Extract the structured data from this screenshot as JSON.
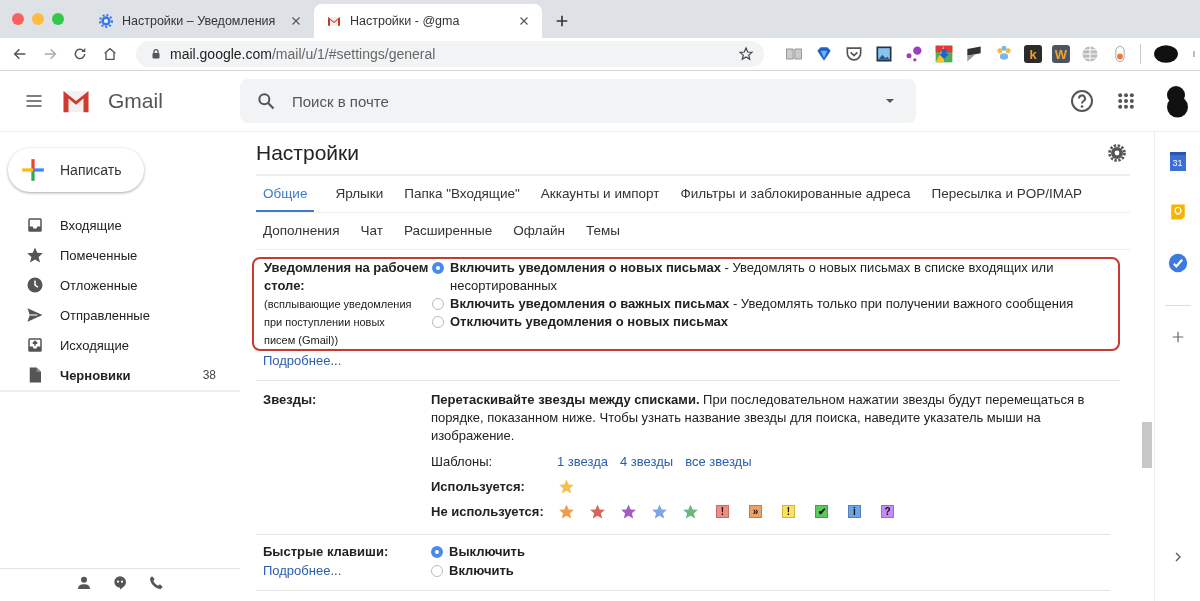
{
  "browser": {
    "tabs": [
      {
        "title": "Настройки – Уведомления",
        "kind": "gear",
        "selected": false
      },
      {
        "title": "Настройки - @gma",
        "kind": "gmail",
        "selected": true
      }
    ],
    "address": {
      "host": "mail.google.com",
      "path": "/mail/u/1/#settings/general"
    },
    "extensions": [
      {
        "kind": "reader"
      },
      {
        "kind": "gem"
      },
      {
        "kind": "pocket"
      },
      {
        "kind": "photo"
      },
      {
        "kind": "dots"
      },
      {
        "kind": "download"
      },
      {
        "kind": "flag"
      },
      {
        "kind": "paw"
      },
      {
        "kind": "letter",
        "glyph": "k",
        "color": "#2b2b2b"
      },
      {
        "kind": "letter",
        "glyph": "W",
        "color": "#4a5563"
      },
      {
        "kind": "globe"
      },
      {
        "kind": "toggle"
      }
    ]
  },
  "app": {
    "name": "Gmail",
    "search": {
      "placeholder": "Поиск в почте"
    }
  },
  "sidebar": {
    "compose": "Написать",
    "items": [
      {
        "label": "Входящие",
        "kind": "inbox",
        "unread": false
      },
      {
        "label": "Помеченные",
        "kind": "star",
        "unread": false
      },
      {
        "label": "Отложенные",
        "kind": "clock",
        "unread": false
      },
      {
        "label": "Отправленные",
        "kind": "send",
        "unread": false
      },
      {
        "label": "Исходящие",
        "kind": "outbox",
        "unread": false
      },
      {
        "label": "Черновики",
        "kind": "draft",
        "unread": true,
        "count": "38"
      }
    ]
  },
  "settings": {
    "title": "Настройки",
    "tab_rows": [
      [
        {
          "label": "Общие",
          "selected": true
        },
        {
          "label": "Ярлыки",
          "selected": false
        },
        {
          "label": "Папка \"Входящие\"",
          "selected": false
        },
        {
          "label": "Аккаунты и импорт",
          "selected": false
        },
        {
          "label": "Фильтры и заблокированные адреса",
          "selected": false
        },
        {
          "label": "Пересылка и POP/IMAP",
          "selected": false
        }
      ],
      [
        {
          "label": "Дополнения",
          "selected": false
        },
        {
          "label": "Чат",
          "selected": false
        },
        {
          "label": "Расширенные",
          "selected": false
        },
        {
          "label": "Офлайн",
          "selected": false
        },
        {
          "label": "Темы",
          "selected": false
        }
      ]
    ],
    "notifications": {
      "label": "Уведомления на рабочем столе:",
      "hint": "(всплывающие уведомления при поступлении новых писем (Gmail))",
      "highlighted": true,
      "options": [
        {
          "text": "**Включить уведомления о новых письмах** - Уведомлять о новых письмах в списке входящих или несортированных",
          "selected": true
        },
        {
          "text": "**Включить уведомления о важных письмах** - Уведомлять только при получении важного сообщения",
          "selected": false
        },
        {
          "text": "Отключить уведомления о новых письмах",
          "selected": false
        }
      ],
      "link": "Подробнее..."
    },
    "stars": {
      "label": "Звезды:",
      "description": "**Перетаскивайте звезды между списками.** При последовательном нажатии звезды будут перемещаться в порядке, показанном ниже. Чтобы узнать название звезды для поиска, наведите указатель мыши на изображение.",
      "presets_label": "Шаблоны:",
      "presets": [
        "1 звезда",
        "4 звезды",
        "все звезды"
      ],
      "in_use_label": "Используется:",
      "in_use": [
        {
          "kind": "star",
          "color": "#f4c150"
        }
      ],
      "unused_label": "Не используется:",
      "unused": [
        {
          "kind": "star",
          "color": "#f09d4a"
        },
        {
          "kind": "star",
          "color": "#d6665b"
        },
        {
          "kind": "star",
          "color": "#a35dbf"
        },
        {
          "kind": "star",
          "color": "#7ba6e8"
        },
        {
          "kind": "star",
          "color": "#6eb77e"
        },
        {
          "kind": "mark",
          "color": "#f28b82",
          "glyph": "!"
        },
        {
          "kind": "mark",
          "color": "#f0a060",
          "glyph": "»"
        },
        {
          "kind": "mark",
          "color": "#fce35a",
          "glyph": "!"
        },
        {
          "kind": "mark",
          "color": "#5ac85a",
          "glyph": "✔"
        },
        {
          "kind": "mark",
          "color": "#6ba4e8",
          "glyph": "i"
        },
        {
          "kind": "mark",
          "color": "#c58af9",
          "glyph": "?"
        }
      ]
    },
    "shortcuts": {
      "label": "Быстрые клавиши:",
      "link": "Подробнее...",
      "options": [
        {
          "label": "Выключить",
          "selected": true
        },
        {
          "label": "Включить",
          "selected": false
        }
      ]
    }
  },
  "side_panel": {
    "apps": [
      {
        "kind": "calendar",
        "glyph": "31"
      },
      {
        "kind": "keep"
      },
      {
        "kind": "tasks"
      }
    ]
  }
}
